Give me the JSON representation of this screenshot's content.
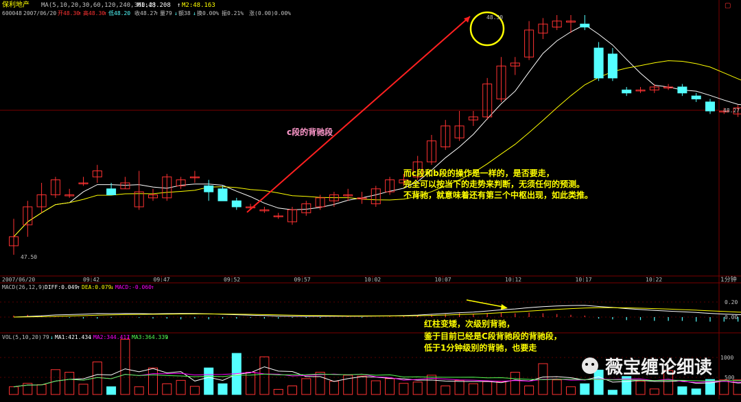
{
  "header": {
    "stock_name": "保利地产",
    "ma_params": "MA(5,10,20,30,60,120,240,360,2)",
    "m1": "M1:48.208",
    "m1_arrow": "↑",
    "m2": "M2:48.163",
    "code": "600048",
    "date": "2007/06/20",
    "open": "开48.30",
    "open_arrow": "↑",
    "high": "高48.30",
    "high_arrow": "↑",
    "low": "低48.20",
    "close": "收48.27",
    "close_arrow": "↑",
    "volume": "量79",
    "volume_arrow": "↓",
    "amount": "额38",
    "amount_arrow": "↓",
    "turnover": "换0.00%",
    "amplitude": "振0.21%",
    "change": "涨(0.00)0.00%"
  },
  "annotations": {
    "c_segment": "c段的背驰段",
    "main_note_1": "而c段和b段的操作是一样的，是否要走，",
    "main_note_2": "完全可以按当下的走势来判断，无须任何的预测。",
    "main_note_3": "不背驰，就意味着还有第三个中枢出现，如此类推。",
    "macd_note_1": "红柱变矮，次级别背驰，",
    "macd_note_2": "鉴于目前已经是C段背驰段的背驰段，",
    "macd_note_3": "低于1分钟级别的背驰，也要走",
    "peak_price": "48.30",
    "low_price": "47.50",
    "right_price": "48.27"
  },
  "time_axis": {
    "start_date": "2007/06/20",
    "labels": [
      "09:42",
      "09:47",
      "09:52",
      "09:57",
      "10:02",
      "10:07",
      "10:12",
      "10:17",
      "10:22"
    ],
    "period": "1分钟"
  },
  "macd": {
    "title": "MACD(26,12,9)",
    "diff": "DIFF:0.049",
    "diff_arrow": "↑",
    "dea": "DEA:0.079",
    "dea_arrow": "↓",
    "macd": "MACD:-0.060",
    "macd_arrow": "↑",
    "ticks": [
      "0.20",
      "0.00"
    ]
  },
  "volume": {
    "title": "VOL(5,10,20)",
    "current": "79",
    "current_arrow": "↓",
    "ma1": "MA1:421.434",
    "ma1_arrow": "↓",
    "ma2": "MA2:344.417",
    "ma2_arrow": "↓",
    "ma3": "MA3:364.339",
    "ma3_arrow": "↓",
    "ticks": [
      "1000",
      "500"
    ]
  },
  "watermark": "薇宝缠论细读",
  "colors": {
    "up": "#ff3232",
    "down": "#54ffff",
    "ma_white": "#ffffff",
    "ma_yellow": "#ffff00",
    "dea_magenta": "#ff00ff",
    "grid": "#7a0000",
    "axis_text": "#c0c0c0",
    "note_yellow": "#ffff00",
    "note_pink": "#ff99cc"
  },
  "chart_data": {
    "type": "candlestick",
    "candles": [
      [
        47.53,
        47.56,
        47.62,
        47.5
      ],
      [
        47.6,
        47.66,
        47.68,
        47.56
      ],
      [
        47.66,
        47.7,
        47.74,
        47.64
      ],
      [
        47.7,
        47.75,
        47.76,
        47.69
      ],
      [
        47.7,
        47.7,
        47.72,
        47.69
      ],
      [
        47.74,
        47.74,
        47.76,
        47.73
      ],
      [
        47.76,
        47.78,
        47.8,
        47.74
      ],
      [
        47.72,
        47.7,
        47.74,
        47.7
      ],
      [
        47.72,
        47.74,
        47.76,
        47.72
      ],
      [
        47.66,
        47.71,
        47.78,
        47.65
      ],
      [
        47.69,
        47.7,
        47.72,
        47.68
      ],
      [
        47.69,
        47.76,
        47.77,
        47.68
      ],
      [
        47.73,
        47.75,
        47.76,
        47.72
      ],
      [
        47.76,
        47.76,
        47.78,
        47.74
      ],
      [
        47.73,
        47.71,
        47.75,
        47.68
      ],
      [
        47.72,
        47.68,
        47.73,
        47.68
      ],
      [
        47.68,
        47.66,
        47.69,
        47.65
      ],
      [
        47.66,
        47.66,
        47.67,
        47.65
      ],
      [
        47.65,
        47.65,
        47.66,
        47.64
      ],
      [
        47.63,
        47.63,
        47.64,
        47.62
      ],
      [
        47.61,
        47.65,
        47.66,
        47.6
      ],
      [
        47.64,
        47.67,
        47.68,
        47.63
      ],
      [
        47.66,
        47.69,
        47.7,
        47.65
      ],
      [
        47.68,
        47.7,
        47.71,
        47.66
      ],
      [
        47.7,
        47.7,
        47.72,
        47.68
      ],
      [
        47.69,
        47.69,
        47.71,
        47.67
      ],
      [
        47.67,
        47.72,
        47.73,
        47.66
      ],
      [
        47.71,
        47.75,
        47.76,
        47.7
      ],
      [
        47.74,
        47.75,
        47.77,
        47.73
      ],
      [
        47.76,
        47.81,
        47.83,
        47.75
      ],
      [
        47.81,
        47.88,
        47.9,
        47.8
      ],
      [
        47.86,
        47.93,
        47.95,
        47.85
      ],
      [
        47.89,
        47.93,
        47.98,
        47.88
      ],
      [
        47.95,
        47.96,
        47.98,
        47.93
      ],
      [
        47.96,
        48.07,
        48.09,
        47.95
      ],
      [
        48.02,
        48.13,
        48.16,
        48.01
      ],
      [
        48.13,
        48.14,
        48.16,
        48.1
      ],
      [
        48.16,
        48.25,
        48.28,
        48.15
      ],
      [
        48.24,
        48.27,
        48.29,
        48.22
      ],
      [
        48.26,
        48.28,
        48.3,
        48.25
      ],
      [
        48.28,
        48.28,
        48.3,
        48.24
      ],
      [
        48.27,
        48.26,
        48.3,
        48.25
      ],
      [
        48.19,
        48.09,
        48.21,
        48.08
      ],
      [
        48.17,
        48.09,
        48.19,
        48.08
      ],
      [
        48.05,
        48.04,
        48.06,
        48.03
      ],
      [
        48.05,
        48.05,
        48.06,
        48.04
      ],
      [
        48.05,
        48.06,
        48.07,
        48.04
      ],
      [
        48.06,
        48.06,
        48.07,
        48.05
      ],
      [
        48.06,
        48.04,
        48.07,
        48.03
      ],
      [
        48.03,
        48.02,
        48.04,
        48.01
      ],
      [
        48.01,
        47.98,
        48.02,
        47.97
      ],
      [
        47.98,
        47.98,
        47.99,
        47.97
      ],
      [
        47.97,
        47.99,
        48.0,
        47.96
      ],
      [
        47.99,
        48.02,
        48.03,
        47.98
      ],
      [
        48.04,
        48.07,
        48.08,
        48.03
      ],
      [
        48.07,
        48.07,
        48.09,
        48.04
      ],
      [
        48.07,
        48.08,
        48.09,
        48.06
      ]
    ],
    "ma_white_last": 48.208,
    "ma_yellow_last": 48.163,
    "macd_hist": [
      0.02,
      0.03,
      0.02,
      0.01,
      -0.01,
      -0.02,
      -0.02,
      -0.01,
      0.0,
      -0.01,
      -0.02,
      -0.02,
      -0.03,
      -0.02,
      -0.03,
      -0.02,
      -0.02,
      -0.01,
      -0.02,
      -0.02,
      -0.01,
      -0.01,
      -0.01,
      0.0,
      0.01,
      -0.01,
      0.0,
      0.01,
      0.01,
      0.02,
      0.03,
      0.04,
      0.05,
      0.04,
      0.05,
      0.06,
      0.05,
      0.06,
      0.05,
      0.04,
      0.03,
      0.02,
      -0.02,
      -0.03,
      -0.04,
      -0.04,
      -0.05,
      -0.05,
      -0.05,
      -0.06,
      -0.06,
      -0.06,
      -0.06,
      -0.06,
      -0.06,
      -0.06,
      -0.06
    ],
    "volumes": [
      180,
      260,
      230,
      580,
      520,
      240,
      760,
      180,
      1290,
      180,
      620,
      250,
      330,
      190,
      620,
      250,
      960,
      520,
      880,
      120,
      200,
      370,
      520,
      310,
      450,
      430,
      320,
      370,
      260,
      290,
      450,
      200,
      330,
      250,
      300,
      300,
      520,
      200,
      720,
      340,
      180,
      250,
      570,
      100,
      420,
      310,
      130,
      560,
      180,
      130,
      350,
      340,
      340,
      280,
      960,
      420,
      79
    ]
  }
}
